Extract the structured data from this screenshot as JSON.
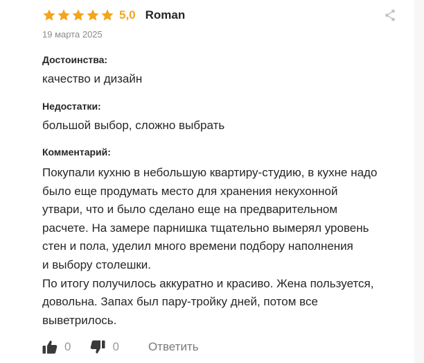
{
  "review": {
    "rating_value": 5,
    "rating_max": 5,
    "rating_label": "5,0",
    "author": "Roman",
    "date": "19 марта 2025",
    "pros_label": "Достоинства:",
    "pros_text": "качество и дизайн",
    "cons_label": "Недостатки:",
    "cons_text": "большой выбор, сложно выбрать",
    "comment_label": "Комментарий:",
    "comment_lines": [
      "Покупали кухню в небольшую квартиру-студию, в кухне надо",
      "было еще продумать место для хранения некухонной",
      "утвари, что и было сделано еще на предварительном",
      "расчете. На замере парнишка тщательно вымерял уровень",
      "стен и пола, уделил много времени подбору наполнения",
      "и выбору столешки.",
      "По итогу получилось аккуратно и красиво. Жена пользуется,",
      "довольна. Запах был пару-тройку дней, потом все",
      "выветрилось."
    ]
  },
  "actions": {
    "like_count": "0",
    "dislike_count": "0",
    "reply_label": "Ответить"
  },
  "icons": {
    "star": "star-icon",
    "share": "share-icon",
    "like": "thumbs-up-icon",
    "dislike": "thumbs-down-icon"
  },
  "colors": {
    "star": "#f4a51c",
    "text": "#262626",
    "muted": "#8a8a8a",
    "icon_dark": "#3a3a3a",
    "share_icon": "#c4c4c4"
  }
}
